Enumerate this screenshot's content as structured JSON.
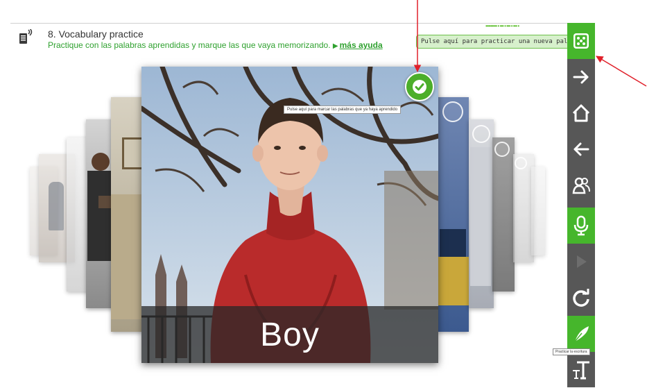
{
  "header": {
    "title": "8. Vocabulary practice",
    "instructions": "Practique con las palabras aprendidas y marque las que vaya memorizando.",
    "help_arrow": "▶",
    "help_link": "más ayuda"
  },
  "progress": {
    "dots": "••••••••• • ••• • ••• • ••• •"
  },
  "tooltips": {
    "new_word": "Pulse aquí para practicar una nueva palabra.",
    "mark_learned": "Pulse aquí para marcar las palabras que ya haya aprendido",
    "writing": "Practicar la escritura"
  },
  "card": {
    "word": "Boy"
  },
  "toolbar": {
    "buttons": [
      {
        "icon": "dice-icon",
        "active": true
      },
      {
        "icon": "arrow-right-icon",
        "active": false
      },
      {
        "icon": "home-icon",
        "active": false
      },
      {
        "icon": "arrow-left-icon",
        "active": false
      },
      {
        "icon": "users-icon",
        "active": false
      },
      {
        "icon": "microphone-icon",
        "active": true
      },
      {
        "icon": "play-icon",
        "active": false,
        "disabled": true
      },
      {
        "icon": "refresh-icon",
        "active": false
      },
      {
        "icon": "quill-icon",
        "active": true
      },
      {
        "icon": "text-size-icon",
        "active": false
      }
    ]
  },
  "colors": {
    "accent_green": "#46b62c",
    "toolbar_gray": "#575757",
    "annotation_red": "#e0202a"
  }
}
